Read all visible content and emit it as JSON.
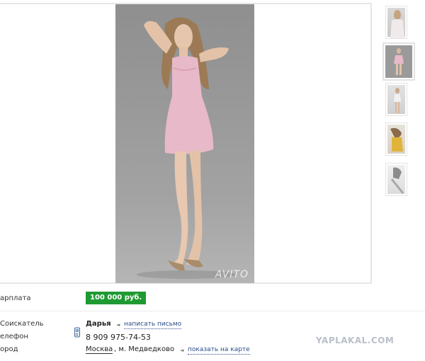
{
  "gallery": {
    "watermark": "AVITO",
    "thumbnails": [
      {
        "name": "photo-1"
      },
      {
        "name": "photo-2",
        "selected": true
      },
      {
        "name": "photo-3"
      },
      {
        "name": "photo-4"
      },
      {
        "name": "photo-5"
      }
    ]
  },
  "details": {
    "salary_label": "арплата",
    "salary_value": "100 000 руб.",
    "seeker_label": "Соискатель",
    "seeker_name": "Дарья",
    "write_letter": "написать письмо",
    "phone_label": "елефон",
    "phone_value": "8 909 975-74-53",
    "city_label": "ород",
    "city_value": "Москва",
    "metro_value": ", м. Медведково",
    "show_on_map": "показать на карте"
  },
  "site_logo": "YAPLAKAL.COM",
  "colors": {
    "salary_badge": "#1f9a33",
    "link": "#2a4d8a"
  }
}
